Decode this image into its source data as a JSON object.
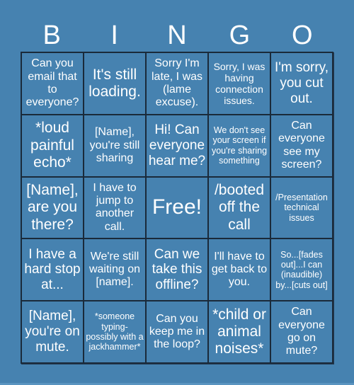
{
  "header": {
    "letters": [
      "B",
      "I",
      "N",
      "G",
      "O"
    ]
  },
  "card": {
    "cells": [
      "Can you email that to everyone?",
      "It's still loading.",
      "Sorry I'm late, I was (lame excuse).",
      "Sorry, I was having connection issues.",
      "I'm sorry, you cut out.",
      "*loud painful echo*",
      "[Name], you're still sharing",
      "Hi! Can everyone hear me?",
      "We don't see your screen if you're sharing something",
      "Can everyone see my screen?",
      "[Name], are you there?",
      "I have to jump to another call.",
      "Free!",
      "/booted off the call",
      "/Presentation technical issues",
      "I have a hard stop at...",
      "We're still waiting on [name].",
      "Can we take this offline?",
      "I'll have to get back to you.",
      "So...[fades out]...I can (inaudible) by...[cuts out]",
      "[Name], you're on mute.",
      "*someone typing- possibly with a jackhammer*",
      "Can you keep me in the loop?",
      "*child or animal noises*",
      "Can everyone go on mute?"
    ]
  },
  "colors": {
    "background": "#4682b0",
    "grid_line": "#1a2a3a",
    "text": "#ffffff"
  }
}
